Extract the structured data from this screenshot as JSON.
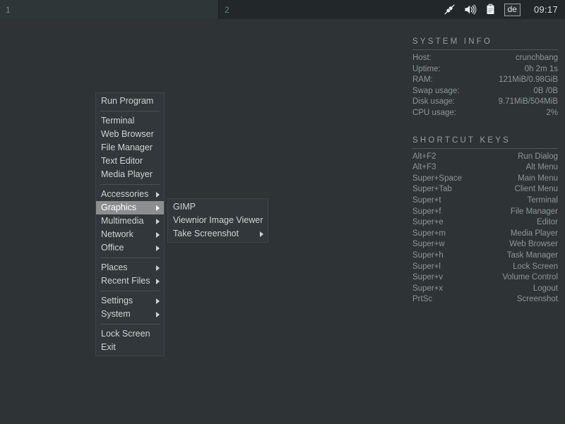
{
  "panel": {
    "workspaces": [
      {
        "label": "1",
        "active": true
      },
      {
        "label": "2",
        "active": false
      }
    ],
    "tray": [
      {
        "name": "network-plug-icon"
      },
      {
        "name": "volume-speaker-icon"
      },
      {
        "name": "clipboard-icon"
      }
    ],
    "keyboard_layout": "de",
    "clock": "09:17"
  },
  "root_menu": {
    "items": [
      {
        "label": "Run Program",
        "submenu": false,
        "highlight": false
      },
      {
        "separator": true
      },
      {
        "label": "Terminal",
        "submenu": false,
        "highlight": false
      },
      {
        "label": "Web Browser",
        "submenu": false,
        "highlight": false
      },
      {
        "label": "File Manager",
        "submenu": false,
        "highlight": false
      },
      {
        "label": "Text Editor",
        "submenu": false,
        "highlight": false
      },
      {
        "label": "Media Player",
        "submenu": false,
        "highlight": false
      },
      {
        "separator": true
      },
      {
        "label": "Accessories",
        "submenu": true,
        "highlight": false
      },
      {
        "label": "Graphics",
        "submenu": true,
        "highlight": true
      },
      {
        "label": "Multimedia",
        "submenu": true,
        "highlight": false
      },
      {
        "label": "Network",
        "submenu": true,
        "highlight": false
      },
      {
        "label": "Office",
        "submenu": true,
        "highlight": false
      },
      {
        "separator": true
      },
      {
        "label": "Places",
        "submenu": true,
        "highlight": false
      },
      {
        "label": "Recent Files",
        "submenu": true,
        "highlight": false
      },
      {
        "separator": true
      },
      {
        "label": "Settings",
        "submenu": true,
        "highlight": false
      },
      {
        "label": "System",
        "submenu": true,
        "highlight": false
      },
      {
        "separator": true
      },
      {
        "label": "Lock Screen",
        "submenu": false,
        "highlight": false
      },
      {
        "label": "Exit",
        "submenu": false,
        "highlight": false
      }
    ]
  },
  "sub_menu": {
    "parent": "Graphics",
    "items": [
      {
        "label": "GIMP",
        "submenu": false
      },
      {
        "label": "Viewnior Image Viewer",
        "submenu": false
      },
      {
        "label": "Take Screenshot",
        "submenu": true
      }
    ]
  },
  "conky": {
    "system_info": {
      "heading": "SYSTEM INFO",
      "rows": [
        {
          "key": "Host:",
          "value": "crunchbang"
        },
        {
          "key": "Uptime:",
          "value": "0h 2m 1s"
        },
        {
          "key": "RAM:",
          "value": "121MiB/0.98GiB"
        },
        {
          "key": "Swap usage:",
          "value": "0B  /0B"
        },
        {
          "key": "Disk usage:",
          "value": "9.71MiB/504MiB"
        },
        {
          "key": "CPU usage:",
          "value": "2%"
        }
      ]
    },
    "shortcut_keys": {
      "heading": "SHORTCUT KEYS",
      "rows": [
        {
          "key": "Alt+F2",
          "value": "Run Dialog"
        },
        {
          "key": "Alt+F3",
          "value": "Alt Menu"
        },
        {
          "key": "Super+Space",
          "value": "Main Menu"
        },
        {
          "key": "Super+Tab",
          "value": "Client Menu"
        },
        {
          "key": "Super+t",
          "value": "Terminal"
        },
        {
          "key": "Super+f",
          "value": "File Manager"
        },
        {
          "key": "Super+e",
          "value": "Editor"
        },
        {
          "key": "Super+m",
          "value": "Media Player"
        },
        {
          "key": "Super+w",
          "value": "Web Browser"
        },
        {
          "key": "Super+h",
          "value": "Task Manager"
        },
        {
          "key": "Super+l",
          "value": "Lock Screen"
        },
        {
          "key": "Super+v",
          "value": "Volume Control"
        },
        {
          "key": "Super+x",
          "value": "Logout"
        },
        {
          "key": "PrtSc",
          "value": "Screenshot"
        }
      ]
    }
  },
  "colors": {
    "desktop_bg": "#2e3336",
    "panel_bg": "#22282a",
    "menu_bg": "#31373a",
    "menu_text": "#cfd4d5",
    "highlight_bg": "#8b8f90",
    "conky_text": "#8d9698"
  }
}
